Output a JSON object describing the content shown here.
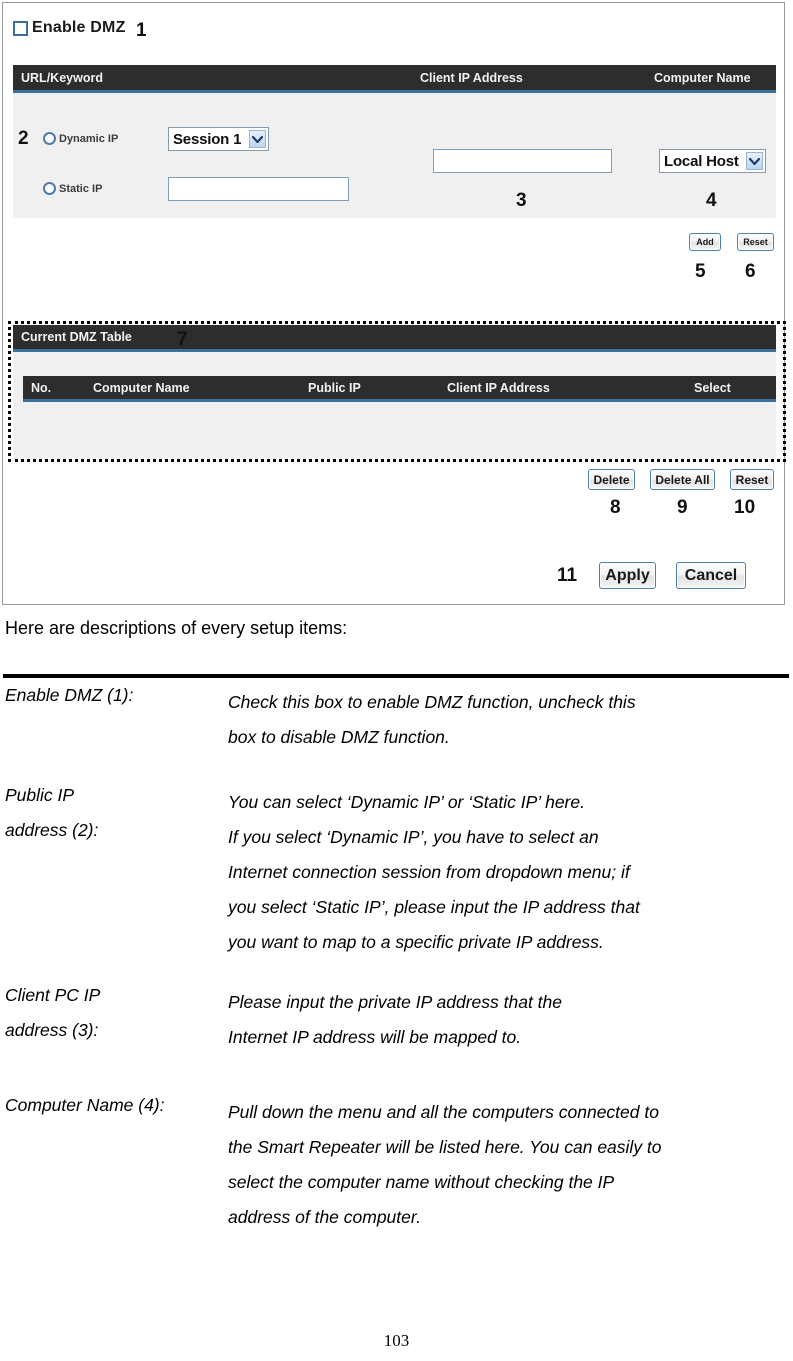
{
  "panel": {
    "enable_dmz": {
      "label": "Enable DMZ",
      "checked": false,
      "callout": "1"
    },
    "form_header": {
      "col_url_keyword": "URL/Keyword",
      "col_client_ip": "Client IP Address",
      "col_computer_name": "Computer Name"
    },
    "public_ip": {
      "callout": "2",
      "dynamic_label": "Dynamic IP",
      "dynamic_selected": false,
      "static_label": "Static IP",
      "static_selected": false,
      "session_select_value": "Session 1",
      "static_ip_value": "",
      "static_ip_placeholder": ""
    },
    "client_ip": {
      "callout": "3",
      "value": "",
      "placeholder": ""
    },
    "computer_name": {
      "callout": "4",
      "select_value": "Local Host"
    },
    "form_buttons": {
      "add": "Add",
      "add_callout": "5",
      "reset": "Reset",
      "reset_callout": "6"
    },
    "dmz_table": {
      "title": "Current DMZ Table",
      "callout": "7",
      "columns": [
        "No.",
        "Computer Name",
        "Public IP",
        "Client IP Address",
        "Select"
      ],
      "rows": []
    },
    "table_buttons": {
      "delete": "Delete",
      "delete_callout": "8",
      "delete_all": "Delete All",
      "delete_all_callout": "9",
      "reset": "Reset",
      "reset_callout": "10"
    },
    "apply_row": {
      "callout": "11",
      "apply": "Apply",
      "cancel": "Cancel"
    },
    "colors": {
      "header_bar": "#2d2d2d",
      "header_underline": "#3c719c",
      "form_background": "#f0f0f0",
      "button_border": "#4d7fad",
      "checkbox_border": "#3f6c9e"
    }
  },
  "document": {
    "intro": "Here are descriptions of every setup items:",
    "items": [
      {
        "term": "Enable DMZ (1):",
        "lines": [
          "Check this box to enable DMZ function, uncheck this",
          "box to disable DMZ function."
        ]
      },
      {
        "term_line1": "Public IP",
        "term_line2": "address (2):",
        "lines": [
          "You can select ‘Dynamic IP’ or ‘Static IP’ here.",
          "If you select ‘Dynamic IP’, you have to select an",
          "Internet connection session from dropdown menu; if",
          "you select ‘Static IP’, please input the IP address that",
          "you want to map to a specific private IP address."
        ]
      },
      {
        "term_line1": "Client PC IP",
        "term_line2": "address (3):",
        "lines": [
          "Please input the private IP address that the",
          "Internet IP address will be mapped to."
        ]
      },
      {
        "term": "Computer Name (4):",
        "lines": [
          "Pull down the menu and all the computers connected to",
          "the Smart Repeater will be listed here. You can easily to",
          "select the computer name without checking the IP",
          "address of the computer."
        ]
      }
    ],
    "page_number": "103"
  }
}
